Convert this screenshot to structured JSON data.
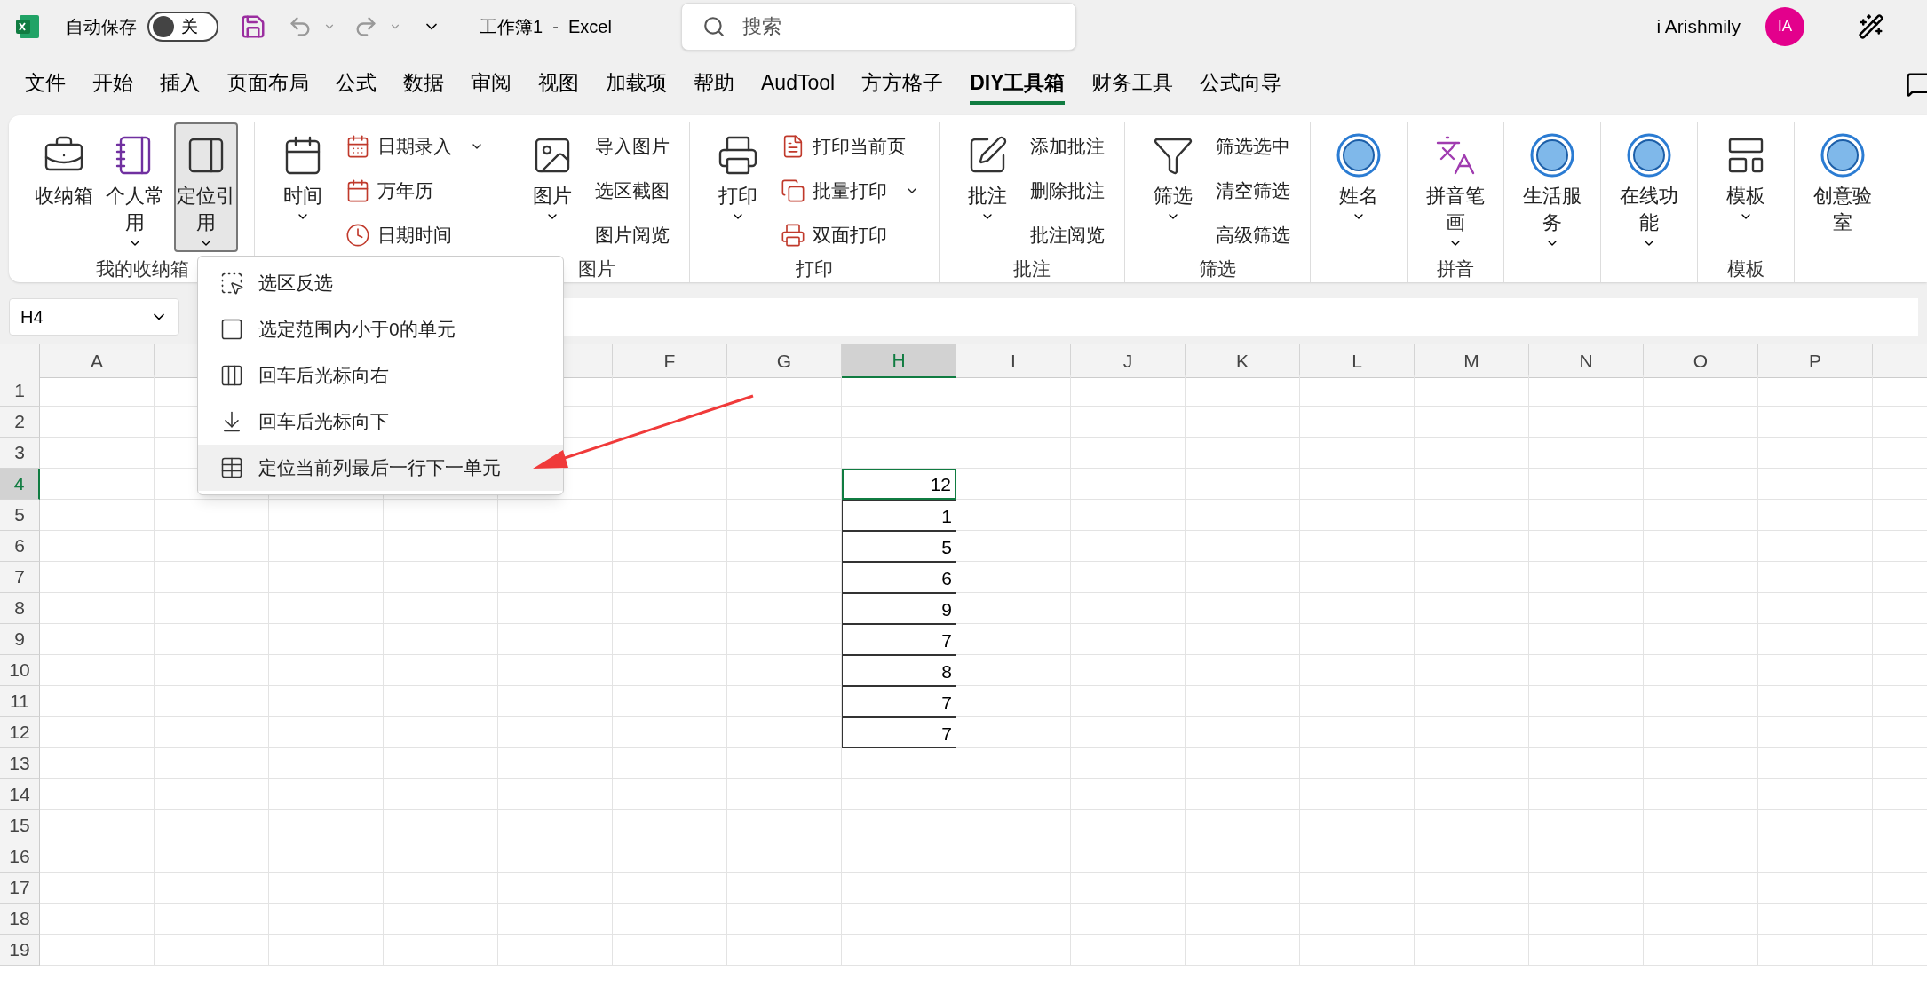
{
  "title_bar": {
    "autosave_label": "自动保存",
    "autosave": {
      "on": false,
      "text": "关"
    },
    "title": "工作簿1  -  Excel",
    "search": {
      "placeholder": "搜索"
    },
    "user": "i Arishmily",
    "avatar": "IA"
  },
  "tabs": [
    {
      "label": "文件",
      "selected": false
    },
    {
      "label": "开始",
      "selected": false
    },
    {
      "label": "插入",
      "selected": false
    },
    {
      "label": "页面布局",
      "selected": false
    },
    {
      "label": "公式",
      "selected": false
    },
    {
      "label": "数据",
      "selected": false
    },
    {
      "label": "审阅",
      "selected": false
    },
    {
      "label": "视图",
      "selected": false
    },
    {
      "label": "加载项",
      "selected": false
    },
    {
      "label": "帮助",
      "selected": false
    },
    {
      "label": "AudTool",
      "selected": false
    },
    {
      "label": "方方格子",
      "selected": false
    },
    {
      "label": "DIY工具箱",
      "selected": true
    },
    {
      "label": "财务工具",
      "selected": false
    },
    {
      "label": "公式向导",
      "selected": false
    }
  ],
  "ribbon": [
    {
      "label": "我的收纳箱",
      "large": [
        {
          "label": "收纳箱",
          "dropdown": false,
          "pressed": false
        },
        {
          "label": "个人常用",
          "dropdown": true,
          "pressed": false
        },
        {
          "label": "定位引用",
          "dropdown": true,
          "pressed": true
        }
      ]
    },
    {
      "large": [
        {
          "label": "时间",
          "dropdown": true,
          "pressed": false
        }
      ],
      "small": [
        {
          "label": "日期录入",
          "dropdown": true
        },
        {
          "label": "万年历",
          "dropdown": false
        },
        {
          "label": "日期时间",
          "dropdown": false
        }
      ]
    },
    {
      "label": "图片",
      "large": [
        {
          "label": "图片",
          "dropdown": true,
          "pressed": false
        }
      ],
      "small": [
        {
          "label": "导入图片",
          "dropdown": false
        },
        {
          "label": "选区截图",
          "dropdown": false
        },
        {
          "label": "图片阅览",
          "dropdown": false
        }
      ]
    },
    {
      "label": "打印",
      "large": [
        {
          "label": "打印",
          "dropdown": true,
          "pressed": false
        }
      ],
      "small": [
        {
          "label": "打印当前页",
          "dropdown": false
        },
        {
          "label": "批量打印",
          "dropdown": true
        },
        {
          "label": "双面打印",
          "dropdown": false
        }
      ]
    },
    {
      "label": "批注",
      "large": [
        {
          "label": "批注",
          "dropdown": true,
          "pressed": false
        }
      ],
      "small": [
        {
          "label": "添加批注",
          "dropdown": false
        },
        {
          "label": "删除批注",
          "dropdown": false
        },
        {
          "label": "批注阅览",
          "dropdown": false
        }
      ]
    },
    {
      "label": "筛选",
      "large": [
        {
          "label": "筛选",
          "dropdown": true,
          "pressed": false
        }
      ],
      "small": [
        {
          "label": "筛选选中",
          "dropdown": false
        },
        {
          "label": "清空筛选",
          "dropdown": false
        },
        {
          "label": "高级筛选",
          "dropdown": false
        }
      ]
    },
    {
      "large": [
        {
          "label": "姓名",
          "dropdown": true,
          "pressed": false
        }
      ]
    },
    {
      "label": "拼音",
      "large": [
        {
          "label": "拼音笔画",
          "dropdown": true,
          "pressed": false
        }
      ]
    },
    {
      "large": [
        {
          "label": "生活服务",
          "dropdown": true,
          "pressed": false
        }
      ]
    },
    {
      "large": [
        {
          "label": "在线功能",
          "dropdown": true,
          "pressed": false
        }
      ]
    },
    {
      "label": "模板",
      "large": [
        {
          "label": "模板",
          "dropdown": true,
          "pressed": false
        }
      ]
    },
    {
      "large": [
        {
          "label": "创意验室",
          "dropdown": false,
          "pressed": false
        }
      ]
    }
  ],
  "menu": [
    {
      "label": "选区反选",
      "highlighted": false
    },
    {
      "label": "选定范围内小于0的单元",
      "highlighted": false
    },
    {
      "label": "回车后光标向右",
      "highlighted": false
    },
    {
      "label": "回车后光标向下",
      "highlighted": false
    },
    {
      "label": "定位当前列最后一行下一单元",
      "highlighted": true
    }
  ],
  "name_box": "H4",
  "sheet": {
    "columns": [
      {
        "kind": "header",
        "label": "A",
        "selected": false
      },
      {
        "kind": "covered"
      },
      {
        "kind": "covered"
      },
      {
        "kind": "covered"
      },
      {
        "kind": "covered"
      },
      {
        "kind": "header",
        "label": "F",
        "selected": false
      },
      {
        "kind": "header",
        "label": "G",
        "selected": false
      },
      {
        "kind": "header",
        "label": "H",
        "selected": true
      },
      {
        "kind": "header",
        "label": "I",
        "selected": false
      },
      {
        "kind": "header",
        "label": "J",
        "selected": false
      },
      {
        "kind": "header",
        "label": "K",
        "selected": false
      },
      {
        "kind": "header",
        "label": "L",
        "selected": false
      },
      {
        "kind": "header",
        "label": "M",
        "selected": false
      },
      {
        "kind": "header",
        "label": "N",
        "selected": false
      },
      {
        "kind": "header",
        "label": "O",
        "selected": false
      },
      {
        "kind": "header",
        "label": "P",
        "selected": false
      }
    ],
    "rows": [
      {
        "label": "1",
        "selected": false
      },
      {
        "label": "2",
        "selected": false
      },
      {
        "label": "3",
        "selected": false
      },
      {
        "label": "4",
        "selected": true,
        "value": "12"
      },
      {
        "label": "5",
        "selected": false,
        "value": "1"
      },
      {
        "label": "6",
        "selected": false,
        "value": "5"
      },
      {
        "label": "7",
        "selected": false,
        "value": "6"
      },
      {
        "label": "8",
        "selected": false,
        "value": "9"
      },
      {
        "label": "9",
        "selected": false,
        "value": "7"
      },
      {
        "label": "10",
        "selected": false,
        "value": "8"
      },
      {
        "label": "11",
        "selected": false,
        "value": "7"
      },
      {
        "label": "12",
        "selected": false,
        "value": "7"
      },
      {
        "label": "13",
        "selected": false
      },
      {
        "label": "14",
        "selected": false
      },
      {
        "label": "15",
        "selected": false
      },
      {
        "label": "16",
        "selected": false
      },
      {
        "label": "17",
        "selected": false
      },
      {
        "label": "18",
        "selected": false
      },
      {
        "label": "19",
        "selected": false
      }
    ]
  }
}
